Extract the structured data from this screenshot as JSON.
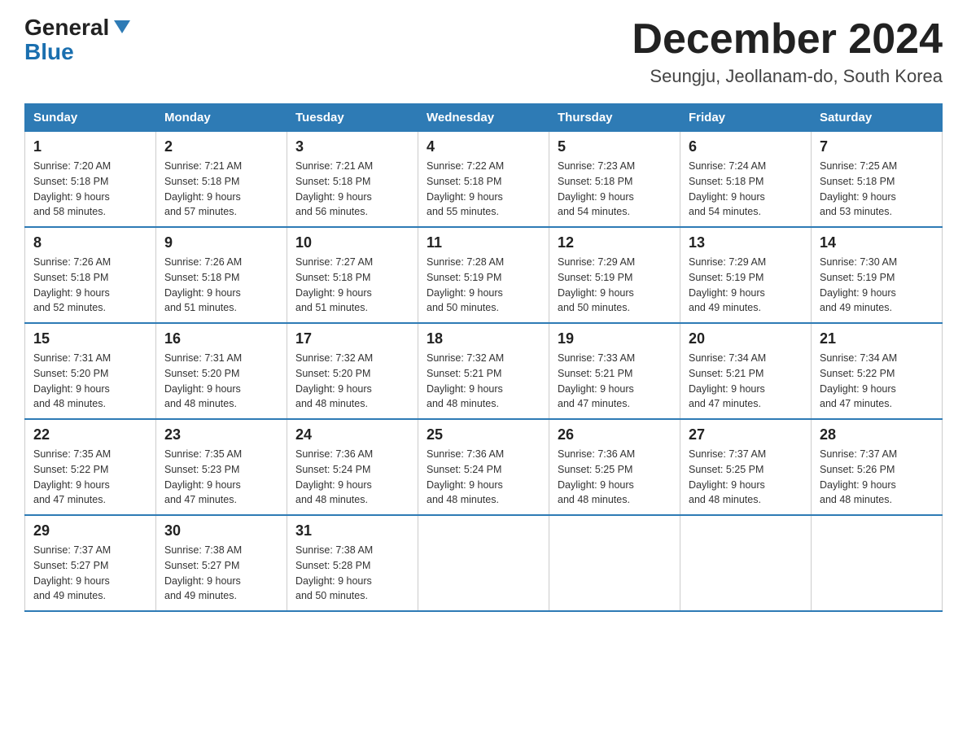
{
  "logo": {
    "general": "General",
    "blue": "Blue"
  },
  "title": "December 2024",
  "subtitle": "Seungju, Jeollanam-do, South Korea",
  "days_header": [
    "Sunday",
    "Monday",
    "Tuesday",
    "Wednesday",
    "Thursday",
    "Friday",
    "Saturday"
  ],
  "weeks": [
    [
      {
        "day": "1",
        "sunrise": "7:20 AM",
        "sunset": "5:18 PM",
        "daylight": "9 hours and 58 minutes."
      },
      {
        "day": "2",
        "sunrise": "7:21 AM",
        "sunset": "5:18 PM",
        "daylight": "9 hours and 57 minutes."
      },
      {
        "day": "3",
        "sunrise": "7:21 AM",
        "sunset": "5:18 PM",
        "daylight": "9 hours and 56 minutes."
      },
      {
        "day": "4",
        "sunrise": "7:22 AM",
        "sunset": "5:18 PM",
        "daylight": "9 hours and 55 minutes."
      },
      {
        "day": "5",
        "sunrise": "7:23 AM",
        "sunset": "5:18 PM",
        "daylight": "9 hours and 54 minutes."
      },
      {
        "day": "6",
        "sunrise": "7:24 AM",
        "sunset": "5:18 PM",
        "daylight": "9 hours and 54 minutes."
      },
      {
        "day": "7",
        "sunrise": "7:25 AM",
        "sunset": "5:18 PM",
        "daylight": "9 hours and 53 minutes."
      }
    ],
    [
      {
        "day": "8",
        "sunrise": "7:26 AM",
        "sunset": "5:18 PM",
        "daylight": "9 hours and 52 minutes."
      },
      {
        "day": "9",
        "sunrise": "7:26 AM",
        "sunset": "5:18 PM",
        "daylight": "9 hours and 51 minutes."
      },
      {
        "day": "10",
        "sunrise": "7:27 AM",
        "sunset": "5:18 PM",
        "daylight": "9 hours and 51 minutes."
      },
      {
        "day": "11",
        "sunrise": "7:28 AM",
        "sunset": "5:19 PM",
        "daylight": "9 hours and 50 minutes."
      },
      {
        "day": "12",
        "sunrise": "7:29 AM",
        "sunset": "5:19 PM",
        "daylight": "9 hours and 50 minutes."
      },
      {
        "day": "13",
        "sunrise": "7:29 AM",
        "sunset": "5:19 PM",
        "daylight": "9 hours and 49 minutes."
      },
      {
        "day": "14",
        "sunrise": "7:30 AM",
        "sunset": "5:19 PM",
        "daylight": "9 hours and 49 minutes."
      }
    ],
    [
      {
        "day": "15",
        "sunrise": "7:31 AM",
        "sunset": "5:20 PM",
        "daylight": "9 hours and 48 minutes."
      },
      {
        "day": "16",
        "sunrise": "7:31 AM",
        "sunset": "5:20 PM",
        "daylight": "9 hours and 48 minutes."
      },
      {
        "day": "17",
        "sunrise": "7:32 AM",
        "sunset": "5:20 PM",
        "daylight": "9 hours and 48 minutes."
      },
      {
        "day": "18",
        "sunrise": "7:32 AM",
        "sunset": "5:21 PM",
        "daylight": "9 hours and 48 minutes."
      },
      {
        "day": "19",
        "sunrise": "7:33 AM",
        "sunset": "5:21 PM",
        "daylight": "9 hours and 47 minutes."
      },
      {
        "day": "20",
        "sunrise": "7:34 AM",
        "sunset": "5:21 PM",
        "daylight": "9 hours and 47 minutes."
      },
      {
        "day": "21",
        "sunrise": "7:34 AM",
        "sunset": "5:22 PM",
        "daylight": "9 hours and 47 minutes."
      }
    ],
    [
      {
        "day": "22",
        "sunrise": "7:35 AM",
        "sunset": "5:22 PM",
        "daylight": "9 hours and 47 minutes."
      },
      {
        "day": "23",
        "sunrise": "7:35 AM",
        "sunset": "5:23 PM",
        "daylight": "9 hours and 47 minutes."
      },
      {
        "day": "24",
        "sunrise": "7:36 AM",
        "sunset": "5:24 PM",
        "daylight": "9 hours and 48 minutes."
      },
      {
        "day": "25",
        "sunrise": "7:36 AM",
        "sunset": "5:24 PM",
        "daylight": "9 hours and 48 minutes."
      },
      {
        "day": "26",
        "sunrise": "7:36 AM",
        "sunset": "5:25 PM",
        "daylight": "9 hours and 48 minutes."
      },
      {
        "day": "27",
        "sunrise": "7:37 AM",
        "sunset": "5:25 PM",
        "daylight": "9 hours and 48 minutes."
      },
      {
        "day": "28",
        "sunrise": "7:37 AM",
        "sunset": "5:26 PM",
        "daylight": "9 hours and 48 minutes."
      }
    ],
    [
      {
        "day": "29",
        "sunrise": "7:37 AM",
        "sunset": "5:27 PM",
        "daylight": "9 hours and 49 minutes."
      },
      {
        "day": "30",
        "sunrise": "7:38 AM",
        "sunset": "5:27 PM",
        "daylight": "9 hours and 49 minutes."
      },
      {
        "day": "31",
        "sunrise": "7:38 AM",
        "sunset": "5:28 PM",
        "daylight": "9 hours and 50 minutes."
      },
      null,
      null,
      null,
      null
    ]
  ],
  "labels": {
    "sunrise": "Sunrise:",
    "sunset": "Sunset:",
    "daylight": "Daylight:"
  }
}
